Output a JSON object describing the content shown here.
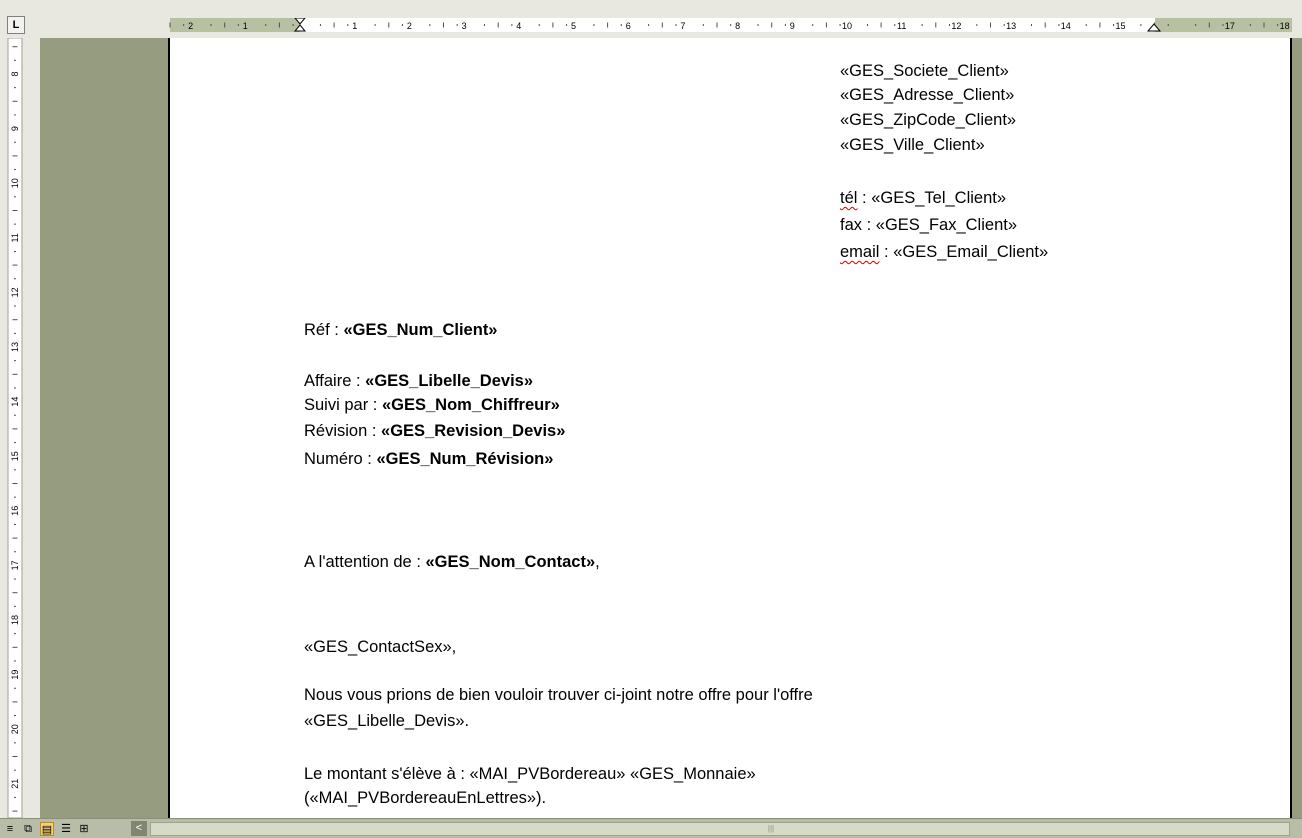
{
  "ruler": {
    "tab_selector": "L",
    "horizontal_labels": [
      "2",
      "1",
      "1",
      "2",
      "3",
      "4",
      "5",
      "6",
      "7",
      "8",
      "9",
      "10",
      "11",
      "12",
      "13",
      "14",
      "15",
      "17",
      "18"
    ],
    "vertical_labels": [
      "8",
      "9",
      "10",
      "11",
      "12",
      "13",
      "14",
      "15",
      "16",
      "17",
      "18",
      "19",
      "20",
      "21"
    ]
  },
  "address_block": {
    "societe": "«GES_Societe_Client»",
    "adresse": "«GES_Adresse_Client»",
    "zipcode": "«GES_ZipCode_Client»",
    "ville": "«GES_Ville_Client»",
    "tel_label": "tél",
    "tel_value": " : «GES_Tel_Client»",
    "fax": "fax : «GES_Fax_Client»",
    "email_label": "email",
    "email_value": " : «GES_Email_Client»"
  },
  "reference": {
    "ref_label": "Réf : ",
    "ref_value": "«GES_Num_Client»",
    "affaire_label": "Affaire : ",
    "affaire_value": "«GES_Libelle_Devis»",
    "suivi_label": "Suivi par : ",
    "suivi_value": "«GES_Nom_Chiffreur»",
    "revision_label": "Révision : ",
    "revision_value": "«GES_Revision_Devis»",
    "numero_label": "Numéro : ",
    "numero_value": "«GES_Num_Révision»"
  },
  "attention": {
    "label": "A l'attention de : ",
    "value": "«GES_Nom_Contact»",
    "suffix": ","
  },
  "body": {
    "salutation": "«GES_ContactSex»,",
    "offer_line1": "Nous vous prions de bien vouloir trouver ci-joint notre offre pour l'offre",
    "offer_line2": "«GES_Libelle_Devis».",
    "amount_line1": "Le montant s'élève à : «MAI_PVBordereau» «GES_Monnaie»",
    "amount_line2": "(«MAI_PVBordereauEnLettres»)."
  },
  "status": {
    "scroll_left": "<",
    "grip": "|||",
    "view_icons": [
      "≡",
      "⧉",
      "▤",
      "☰",
      "⊞"
    ]
  }
}
